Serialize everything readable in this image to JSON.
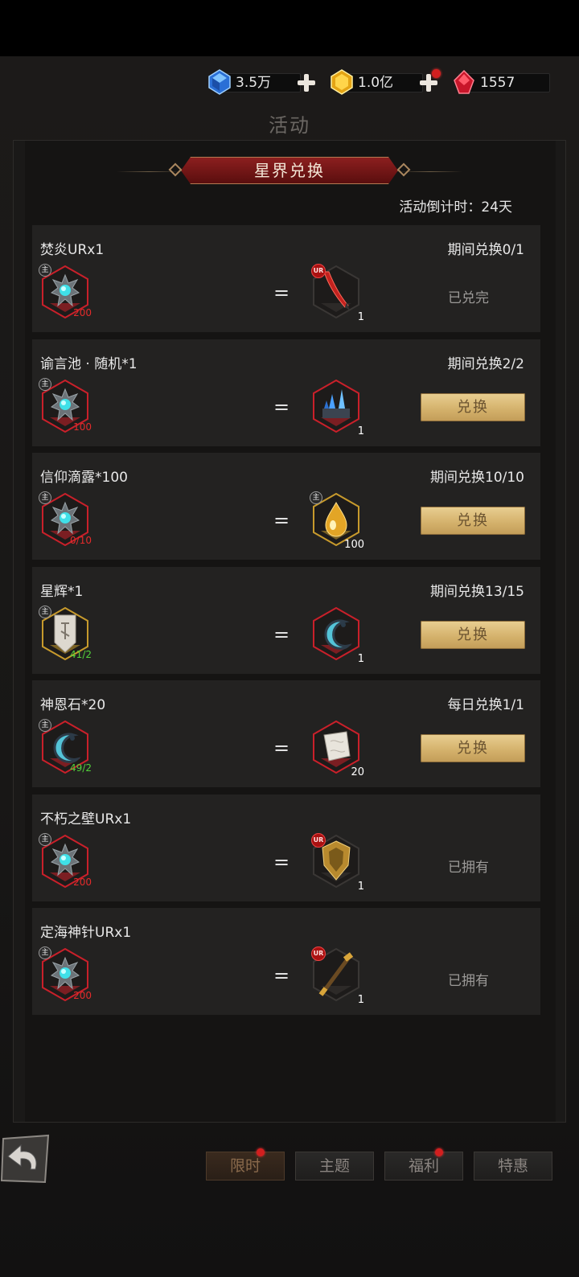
{
  "currencies": [
    {
      "icon": "blue-gem-icon",
      "value": "3.5万",
      "has_plus": true,
      "has_dot": false
    },
    {
      "icon": "gold-gem-icon",
      "value": "1.0亿",
      "has_plus": true,
      "has_dot": true
    },
    {
      "icon": "red-crystal-icon",
      "value": "1557",
      "has_plus": false,
      "has_dot": false
    }
  ],
  "page_title": "活动",
  "banner_title": "星界兑换",
  "countdown": "活动倒计时：24天",
  "exchange_items": [
    {
      "title": "焚炎URx1",
      "quota": "期间兑换0/1",
      "cost_icon": "star-crystal-icon",
      "cost_count": "200",
      "cost_count_color": "red",
      "cost_tag": "主",
      "reward_icon": "flame-blade-icon",
      "reward_tag": "UR",
      "reward_count": "1",
      "action_type": "status",
      "action_text": "已兑完"
    },
    {
      "title": "谕言池 · 随机*1",
      "quota": "期间兑换2/2",
      "cost_icon": "star-crystal-icon",
      "cost_count": "100",
      "cost_count_color": "red",
      "cost_tag": "主",
      "reward_icon": "crystal-altar-icon",
      "reward_tag": "",
      "reward_count": "1",
      "action_type": "button",
      "action_text": "兑换"
    },
    {
      "title": "信仰滴露*100",
      "quota": "期间兑换10/10",
      "cost_icon": "star-crystal-icon",
      "cost_count": "0/10",
      "cost_count_color": "red",
      "cost_tag": "主",
      "reward_icon": "golden-droplet-icon",
      "reward_tag": "主",
      "reward_count": "100",
      "action_type": "button",
      "action_text": "兑换"
    },
    {
      "title": "星辉*1",
      "quota": "期间兑换13/15",
      "cost_icon": "rune-tablet-icon",
      "cost_count": "41/2",
      "cost_count_color": "green",
      "cost_tag": "主",
      "reward_icon": "crescent-stone-icon",
      "reward_tag": "",
      "reward_count": "1",
      "action_type": "button",
      "action_text": "兑换"
    },
    {
      "title": "神恩石*20",
      "quota": "每日兑换1/1",
      "cost_icon": "crescent-stone-icon",
      "cost_count": "49/2",
      "cost_count_color": "green",
      "cost_tag": "主",
      "reward_icon": "white-stone-icon",
      "reward_tag": "",
      "reward_count": "20",
      "action_type": "button",
      "action_text": "兑换"
    },
    {
      "title": "不朽之壁URx1",
      "quota": "",
      "cost_icon": "star-crystal-icon",
      "cost_count": "200",
      "cost_count_color": "red",
      "cost_tag": "主",
      "reward_icon": "golden-shield-icon",
      "reward_tag": "UR",
      "reward_count": "1",
      "action_type": "status",
      "action_text": "已拥有"
    },
    {
      "title": "定海神针URx1",
      "quota": "",
      "cost_icon": "star-crystal-icon",
      "cost_count": "200",
      "cost_count_color": "red",
      "cost_tag": "主",
      "reward_icon": "golden-staff-icon",
      "reward_tag": "UR",
      "reward_count": "1",
      "action_type": "status",
      "action_text": "已拥有"
    }
  ],
  "equals_sign": "=",
  "back_icon": "back-arrow-icon",
  "tabs": [
    {
      "label": "限时",
      "active": true,
      "has_dot": true
    },
    {
      "label": "主题",
      "active": false,
      "has_dot": false
    },
    {
      "label": "福利",
      "active": false,
      "has_dot": true
    },
    {
      "label": "特惠",
      "active": false,
      "has_dot": false
    }
  ]
}
